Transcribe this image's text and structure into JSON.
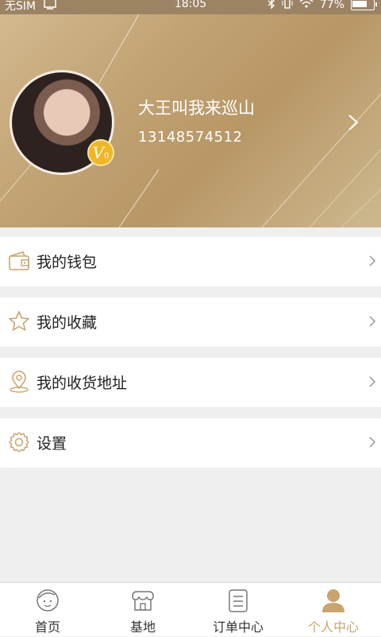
{
  "status_bar": {
    "carrier": "无SIM",
    "time": "18:05",
    "battery": "77%"
  },
  "profile": {
    "username": "大王叫我来巡山",
    "phone": "13148574512",
    "vip_level": "0",
    "vip_letter": "V"
  },
  "menu": [
    {
      "label": "我的钱包",
      "icon": "wallet-icon"
    },
    {
      "label": "我的收藏",
      "icon": "star-icon"
    },
    {
      "label": "我的收货地址",
      "icon": "location-icon"
    },
    {
      "label": "设置",
      "icon": "gear-icon"
    }
  ],
  "bottom_nav": [
    {
      "label": "首页",
      "icon": "home-face-icon",
      "active": false
    },
    {
      "label": "基地",
      "icon": "store-icon",
      "active": false
    },
    {
      "label": "订单中心",
      "icon": "order-list-icon",
      "active": false
    },
    {
      "label": "个人中心",
      "icon": "person-icon",
      "active": true
    }
  ],
  "colors": {
    "accent": "#c9a46c",
    "header_gradient_start": "#d2b98f",
    "header_gradient_end": "#b89766",
    "background": "#efefef",
    "vip_badge": "#f0b624"
  }
}
